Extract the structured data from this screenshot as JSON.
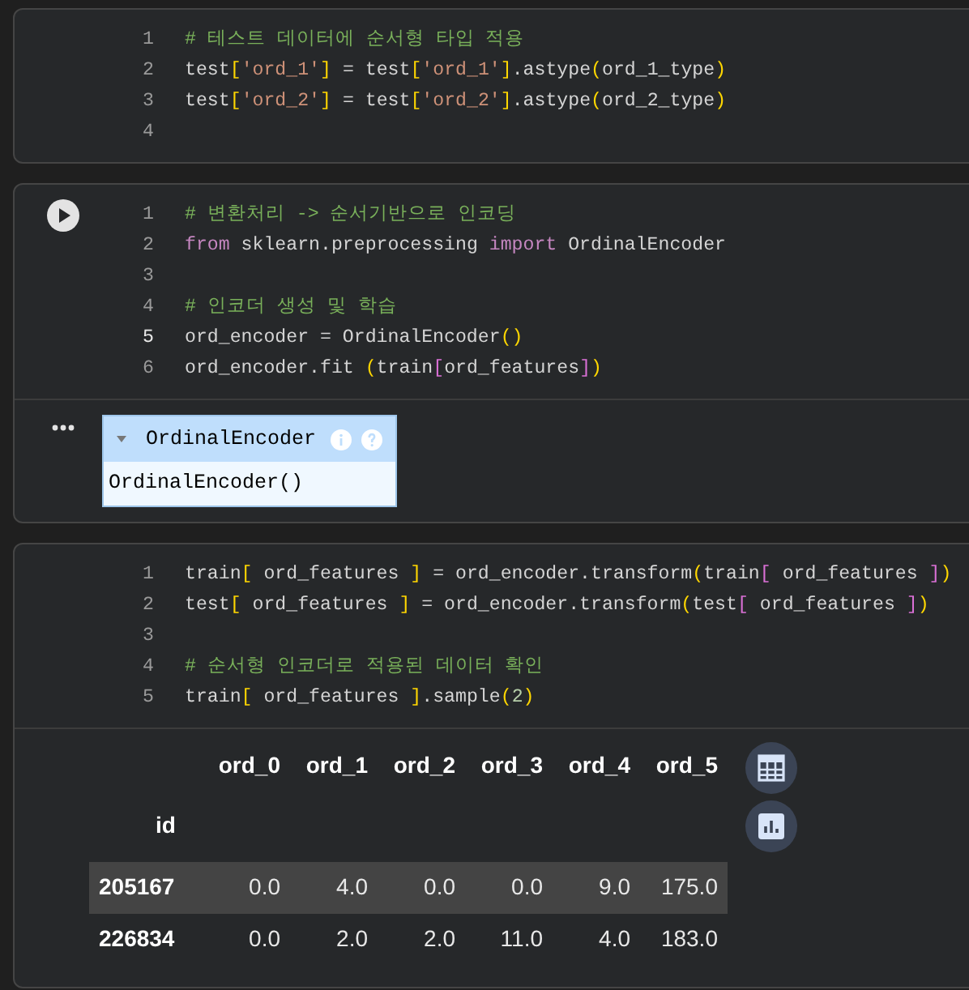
{
  "cells": [
    {
      "show_run_button": false,
      "lines": [
        {
          "number": "1",
          "active": false,
          "tokens": [
            {
              "text": "# 테스트 데이터에 순서형 타입 적용",
              "kind": "comment"
            }
          ]
        },
        {
          "number": "2",
          "active": false,
          "tokens": [
            {
              "text": "test",
              "kind": "plain"
            },
            {
              "text": "[",
              "kind": "bracket"
            },
            {
              "text": "'ord_1'",
              "kind": "string"
            },
            {
              "text": "]",
              "kind": "bracket"
            },
            {
              "text": " = test",
              "kind": "plain"
            },
            {
              "text": "[",
              "kind": "bracket"
            },
            {
              "text": "'ord_1'",
              "kind": "string"
            },
            {
              "text": "]",
              "kind": "bracket"
            },
            {
              "text": ".astype",
              "kind": "plain"
            },
            {
              "text": "(",
              "kind": "bracket"
            },
            {
              "text": "ord_1_type",
              "kind": "plain"
            },
            {
              "text": ")",
              "kind": "bracket"
            }
          ]
        },
        {
          "number": "3",
          "active": false,
          "tokens": [
            {
              "text": "test",
              "kind": "plain"
            },
            {
              "text": "[",
              "kind": "bracket"
            },
            {
              "text": "'ord_2'",
              "kind": "string"
            },
            {
              "text": "]",
              "kind": "bracket"
            },
            {
              "text": " = test",
              "kind": "plain"
            },
            {
              "text": "[",
              "kind": "bracket"
            },
            {
              "text": "'ord_2'",
              "kind": "string"
            },
            {
              "text": "]",
              "kind": "bracket"
            },
            {
              "text": ".astype",
              "kind": "plain"
            },
            {
              "text": "(",
              "kind": "bracket"
            },
            {
              "text": "ord_2_type",
              "kind": "plain"
            },
            {
              "text": ")",
              "kind": "bracket"
            }
          ]
        },
        {
          "number": "4",
          "active": false
        }
      ]
    },
    {
      "show_run_button": true,
      "lines": [
        {
          "number": "1",
          "active": false,
          "tokens": [
            {
              "text": "# 변환처리 -> 순서기반으로 인코딩",
              "kind": "comment"
            }
          ]
        },
        {
          "number": "2",
          "active": false,
          "tokens": [
            {
              "text": "from",
              "kind": "keyword"
            },
            {
              "text": " sklearn.preprocessing ",
              "kind": "plain"
            },
            {
              "text": "import",
              "kind": "keyword"
            },
            {
              "text": " OrdinalEncoder",
              "kind": "plain"
            }
          ]
        },
        {
          "number": "3",
          "active": false
        },
        {
          "number": "4",
          "active": false,
          "tokens": [
            {
              "text": "# 인코더 생성 및 학습",
              "kind": "comment"
            }
          ]
        },
        {
          "number": "5",
          "active": true,
          "tokens": [
            {
              "text": "ord_encoder = OrdinalEncoder",
              "kind": "plain"
            },
            {
              "text": "(",
              "kind": "bracket"
            },
            {
              "text": ")",
              "kind": "bracket"
            }
          ]
        },
        {
          "number": "6",
          "active": false,
          "tokens": [
            {
              "text": "ord_encoder.fit ",
              "kind": "plain"
            },
            {
              "text": "(",
              "kind": "bracket"
            },
            {
              "text": "train",
              "kind": "plain"
            },
            {
              "text": "[",
              "kind": "bracket2"
            },
            {
              "text": "ord_features",
              "kind": "plain"
            },
            {
              "text": "]",
              "kind": "bracket2"
            },
            {
              "text": ")",
              "kind": "bracket"
            }
          ]
        }
      ],
      "output": {
        "kind": "estimator",
        "title": "OrdinalEncoder",
        "body": "OrdinalEncoder()"
      }
    },
    {
      "show_run_button": false,
      "lines": [
        {
          "number": "1",
          "active": false,
          "tokens": [
            {
              "text": "train",
              "kind": "plain"
            },
            {
              "text": "[",
              "kind": "bracket"
            },
            {
              "text": " ord_features ",
              "kind": "plain"
            },
            {
              "text": "]",
              "kind": "bracket"
            },
            {
              "text": " = ord_encoder.transform",
              "kind": "plain"
            },
            {
              "text": "(",
              "kind": "bracket"
            },
            {
              "text": "train",
              "kind": "plain"
            },
            {
              "text": "[",
              "kind": "bracket2"
            },
            {
              "text": " ord_features ",
              "kind": "plain"
            },
            {
              "text": "]",
              "kind": "bracket2"
            },
            {
              "text": ")",
              "kind": "bracket"
            }
          ]
        },
        {
          "number": "2",
          "active": false,
          "tokens": [
            {
              "text": "test",
              "kind": "plain"
            },
            {
              "text": "[",
              "kind": "bracket"
            },
            {
              "text": " ord_features ",
              "kind": "plain"
            },
            {
              "text": "]",
              "kind": "bracket"
            },
            {
              "text": " = ord_encoder.transform",
              "kind": "plain"
            },
            {
              "text": "(",
              "kind": "bracket"
            },
            {
              "text": "test",
              "kind": "plain"
            },
            {
              "text": "[",
              "kind": "bracket2"
            },
            {
              "text": " ord_features ",
              "kind": "plain"
            },
            {
              "text": "]",
              "kind": "bracket2"
            },
            {
              "text": ")",
              "kind": "bracket"
            }
          ]
        },
        {
          "number": "3",
          "active": false
        },
        {
          "number": "4",
          "active": false,
          "tokens": [
            {
              "text": "# 순서형 인코더로 적용된 데이터 확인",
              "kind": "comment"
            }
          ]
        },
        {
          "number": "5",
          "active": false,
          "tokens": [
            {
              "text": "train",
              "kind": "plain"
            },
            {
              "text": "[",
              "kind": "bracket"
            },
            {
              "text": " ord_features ",
              "kind": "plain"
            },
            {
              "text": "]",
              "kind": "bracket"
            },
            {
              "text": ".sample",
              "kind": "plain"
            },
            {
              "text": "(",
              "kind": "bracket"
            },
            {
              "text": "2",
              "kind": "number"
            },
            {
              "text": ")",
              "kind": "bracket"
            }
          ]
        }
      ],
      "output": {
        "kind": "table",
        "columns": [
          "ord_0",
          "ord_1",
          "ord_2",
          "ord_3",
          "ord_4",
          "ord_5"
        ],
        "index_name": "id",
        "rows": [
          {
            "index": "205167",
            "highlighted": true,
            "values": [
              "0.0",
              "4.0",
              "0.0",
              "0.0",
              "9.0",
              "175.0"
            ]
          },
          {
            "index": "226834",
            "highlighted": false,
            "values": [
              "0.0",
              "2.0",
              "2.0",
              "11.0",
              "4.0",
              "183.0"
            ]
          }
        ]
      }
    }
  ]
}
